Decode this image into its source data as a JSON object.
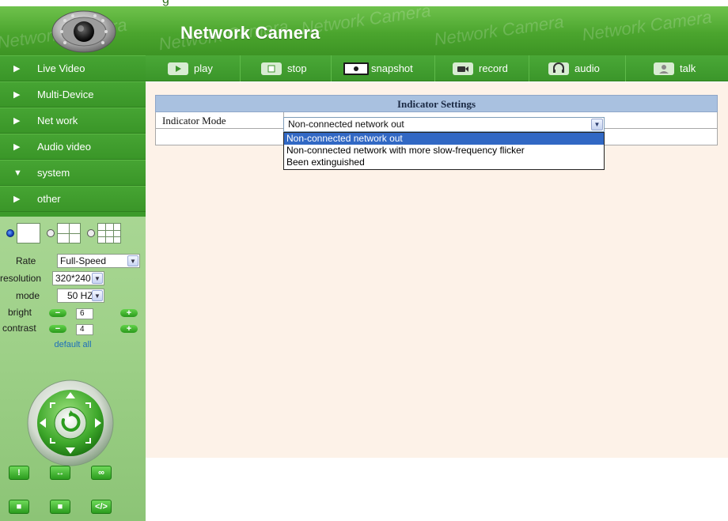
{
  "header": {
    "title": "Network Camera",
    "watermark": "Network Camera",
    "top_fragment": "g"
  },
  "nav": {
    "items": [
      {
        "label": "Live Video",
        "arrow": "▶"
      },
      {
        "label": "Multi-Device",
        "arrow": "▶"
      },
      {
        "label": "Net work",
        "arrow": "▶"
      },
      {
        "label": "Audio video",
        "arrow": "▶"
      },
      {
        "label": "system",
        "arrow": "▼"
      },
      {
        "label": "other",
        "arrow": "▶"
      }
    ]
  },
  "toolbar": {
    "play": "play",
    "stop": "stop",
    "snapshot": "snapshot",
    "record": "record",
    "audio": "audio",
    "talk": "talk"
  },
  "controls": {
    "rate_label": "Rate",
    "rate_value": "Full-Speed",
    "resolution_label": "resolution",
    "resolution_value": "320*240",
    "mode_label": "mode",
    "mode_value": "50 HZ",
    "bright_label": "bright",
    "bright_value": "6",
    "contrast_label": "contrast",
    "contrast_value": "4",
    "default_all": "default all",
    "minus": "−",
    "plus": "+"
  },
  "settings": {
    "title": "Indicator Settings",
    "field_label": "Indicator Mode",
    "selected": "Non-connected network out",
    "options": [
      "Non-connected network out",
      "Non-connected network with more slow-frequency flicker",
      "Been extinguished"
    ]
  },
  "colors": {
    "accent_green": "#3c9a2a",
    "panel_green": "#9fd189",
    "content_bg": "#fdf2e8",
    "table_header": "#a9c1e0",
    "selection_blue": "#3168c4"
  },
  "icons": {
    "play": "play-icon",
    "stop": "stop-icon",
    "snapshot": "snapshot-icon",
    "record": "record-icon",
    "audio": "audio-icon",
    "talk": "talk-icon",
    "ptz": "ptz-control-icon"
  }
}
